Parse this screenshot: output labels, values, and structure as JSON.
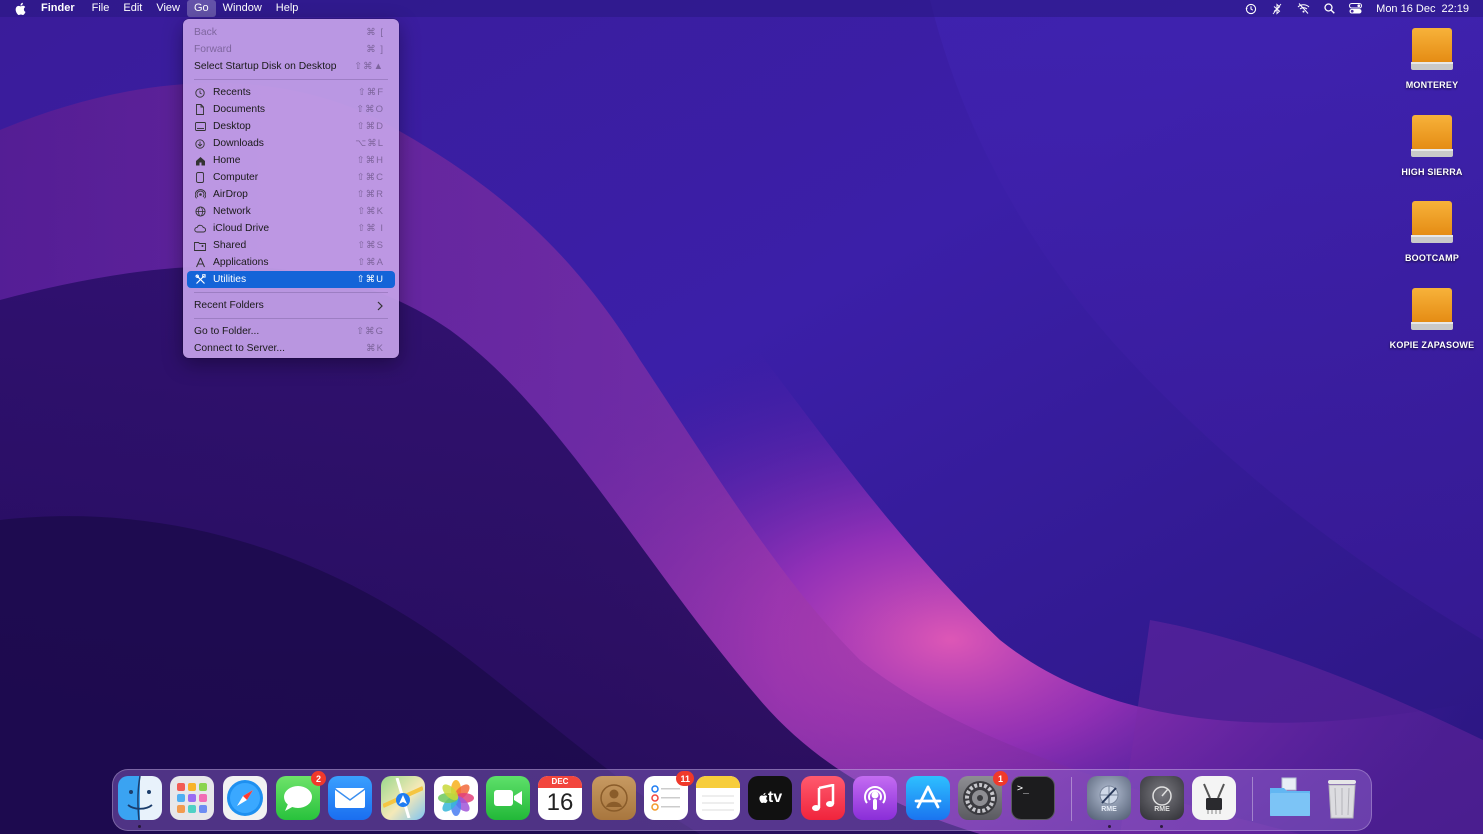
{
  "menubar": {
    "app_name": "Finder",
    "items": [
      "File",
      "Edit",
      "View",
      "Go",
      "Window",
      "Help"
    ],
    "active_item": "Go",
    "clock": {
      "date": "Mon 16 Dec",
      "time": "22:19"
    },
    "status_icons": [
      "time-machine-icon",
      "bluetooth-icon",
      "wifi-off-icon",
      "spotlight-search-icon",
      "control-center-icon"
    ]
  },
  "go_menu": {
    "header_items": [
      {
        "label": "Back",
        "shortcut": "⌘ [",
        "disabled": true
      },
      {
        "label": "Forward",
        "shortcut": "⌘ ]",
        "disabled": true
      },
      {
        "label": "Select Startup Disk on Desktop",
        "shortcut": "⇧⌘▲",
        "disabled": false
      }
    ],
    "places": [
      {
        "label": "Recents",
        "shortcut": "⇧⌘F",
        "icon": "clock-icon"
      },
      {
        "label": "Documents",
        "shortcut": "⇧⌘O",
        "icon": "document-icon"
      },
      {
        "label": "Desktop",
        "shortcut": "⇧⌘D",
        "icon": "desktop-icon"
      },
      {
        "label": "Downloads",
        "shortcut": "⌥⌘L",
        "icon": "download-icon"
      },
      {
        "label": "Home",
        "shortcut": "⇧⌘H",
        "icon": "home-icon"
      },
      {
        "label": "Computer",
        "shortcut": "⇧⌘C",
        "icon": "computer-icon"
      },
      {
        "label": "AirDrop",
        "shortcut": "⇧⌘R",
        "icon": "airdrop-icon"
      },
      {
        "label": "Network",
        "shortcut": "⇧⌘K",
        "icon": "globe-icon"
      },
      {
        "label": "iCloud Drive",
        "shortcut": "⇧⌘ I",
        "icon": "cloud-icon"
      },
      {
        "label": "Shared",
        "shortcut": "⇧⌘S",
        "icon": "shared-folder-icon"
      },
      {
        "label": "Applications",
        "shortcut": "⇧⌘A",
        "icon": "applications-icon"
      },
      {
        "label": "Utilities",
        "shortcut": "⇧⌘U",
        "icon": "utilities-icon",
        "selected": true
      }
    ],
    "recent_folders": {
      "label": "Recent Folders"
    },
    "footer_items": [
      {
        "label": "Go to Folder...",
        "shortcut": "⇧⌘G"
      },
      {
        "label": "Connect to Server...",
        "shortcut": "⌘K"
      }
    ]
  },
  "desktop_drives": [
    {
      "label": "MONTEREY"
    },
    {
      "label": "HIGH SIERRA"
    },
    {
      "label": "BOOTCAMP"
    },
    {
      "label": "KOPIE ZAPASOWE"
    }
  ],
  "dock": {
    "apps": [
      {
        "name": "finder",
        "running": true
      },
      {
        "name": "launchpad"
      },
      {
        "name": "safari"
      },
      {
        "name": "messages",
        "badge": "2"
      },
      {
        "name": "mail"
      },
      {
        "name": "maps"
      },
      {
        "name": "photos"
      },
      {
        "name": "facetime"
      },
      {
        "name": "calendar",
        "month": "DEC",
        "day": "16"
      },
      {
        "name": "contacts"
      },
      {
        "name": "reminders",
        "badge": "11"
      },
      {
        "name": "notes"
      },
      {
        "name": "apple-tv",
        "text": "tv"
      },
      {
        "name": "music"
      },
      {
        "name": "podcasts"
      },
      {
        "name": "app-store"
      },
      {
        "name": "system-preferences",
        "badge": "1"
      },
      {
        "name": "terminal",
        "text": ">_"
      },
      {
        "name": "rme-totalmix",
        "text": "RME",
        "running": true
      },
      {
        "name": "rme-digicheck",
        "text": "RME",
        "running": true
      },
      {
        "name": "system-information"
      },
      {
        "name": "downloads-stack"
      },
      {
        "name": "trash"
      }
    ]
  }
}
